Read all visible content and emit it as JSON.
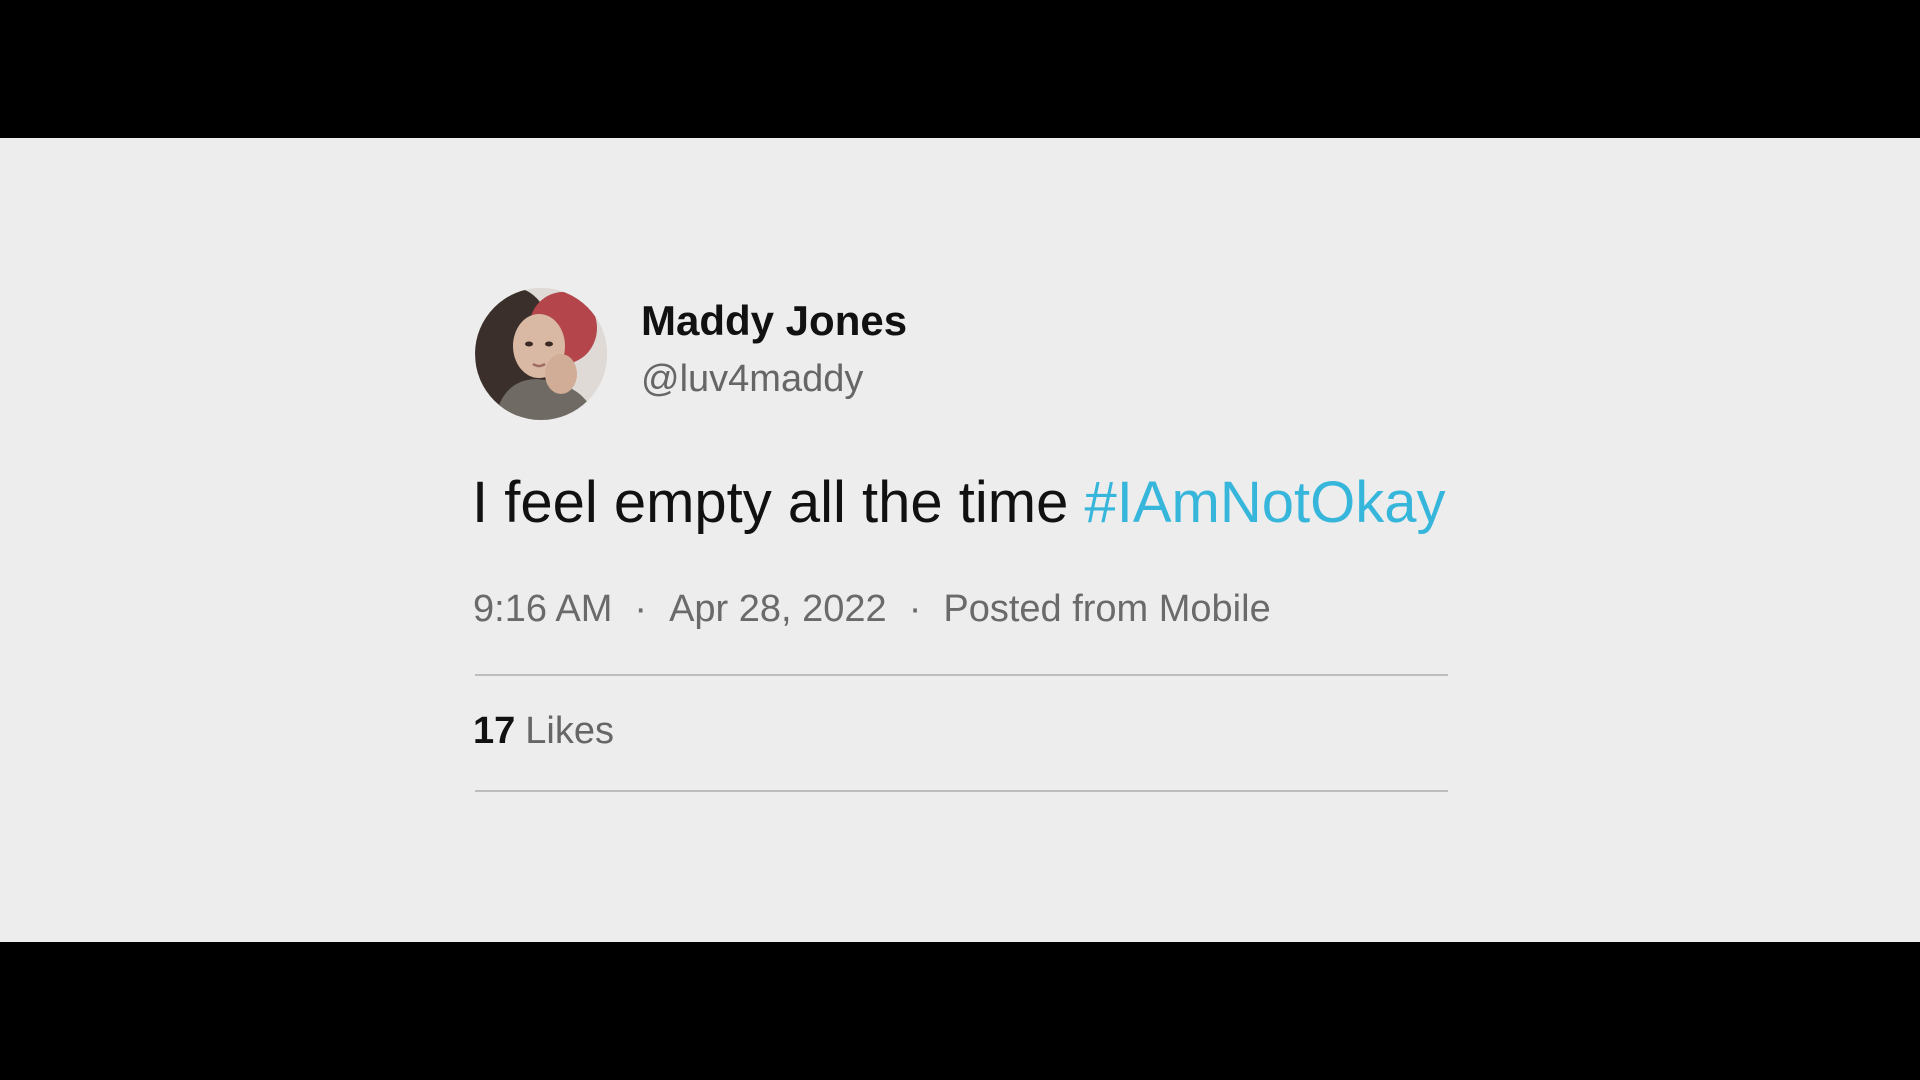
{
  "tweet": {
    "display_name": "Maddy Jones",
    "handle": "@luv4maddy",
    "text": "I feel empty all the time",
    "hashtag": "#IAmNotOkay",
    "time": "9:16 AM",
    "date": "Apr 28, 2022",
    "source": "Posted from Mobile",
    "separator": "·",
    "likes_count": "17",
    "likes_label": "Likes"
  },
  "colors": {
    "background": "#ededed",
    "letterbox": "#000000",
    "hashtag": "#37b6dc",
    "primary_text": "#111111",
    "secondary_text": "#666666"
  },
  "icons": {
    "avatar": "user-profile-photo"
  }
}
